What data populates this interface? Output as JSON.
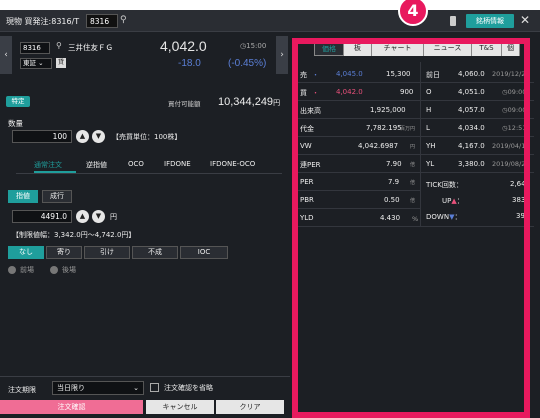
{
  "title": {
    "text": "現物 買発注:8316/T",
    "code": "8316",
    "info_button": "銘柄情報",
    "annotation_number": "4"
  },
  "stock": {
    "code": "8316",
    "name": "三井住友ＦＧ",
    "market": "東証",
    "lend_badge": "貸",
    "price": "4,042.0",
    "time": "15:00",
    "change": "-18.0",
    "change_pct": "(-0.45%)"
  },
  "order": {
    "special_badge": "特定",
    "buy_power_label": "買付可能額",
    "buy_power_value": "10,344,249",
    "buy_power_unit": "円",
    "qty_label": "数量",
    "qty_value": "100",
    "qty_unit": "【売買単位：100株】",
    "tabs": [
      "通常注文",
      "逆指値",
      "OCO",
      "IFDONE",
      "IFDONE-OCO"
    ],
    "price_type_limit": "指値",
    "price_type_market": "成行",
    "price_value": "4491.0",
    "yen": "円",
    "limit_range": "【制限値幅：3,342.0円〜4,742.0円】",
    "conditions": [
      "なし",
      "寄り",
      "引け",
      "不成",
      "IOC"
    ],
    "session_am": "前場",
    "session_pm": "後場",
    "period_label": "注文期限",
    "period_value": "当日限り",
    "skip_confirm": "注文確認を省略",
    "confirm_button": "注文確認",
    "cancel_button": "キャンセル",
    "clear_button": "クリア"
  },
  "info_panel": {
    "tabs": [
      "価格",
      "板",
      "チャート",
      "ニュース",
      "T&S",
      "個"
    ],
    "left_rows": [
      {
        "label": "売",
        "v1": "4,045.0",
        "v2": "15,300"
      },
      {
        "label": "買",
        "v1": "4,042.0",
        "v2": "900"
      },
      {
        "label": "出来高",
        "v1": "",
        "v2": "1,925,000"
      },
      {
        "label": "代金",
        "v1": "",
        "v2": "7,782.195",
        "unit": "百万円"
      },
      {
        "label": "VW",
        "v1": "",
        "v2": "4,042.6987",
        "unit": "円"
      },
      {
        "label": "連PER",
        "v1": "",
        "v2": "7.90",
        "unit": "倍"
      },
      {
        "label": "PER",
        "v1": "",
        "v2": "7.9",
        "unit": "倍"
      },
      {
        "label": "PBR",
        "v1": "",
        "v2": "0.50",
        "unit": "倍"
      },
      {
        "label": "YLD",
        "v1": "",
        "v2": "4.430",
        "unit": "%"
      }
    ],
    "right_rows": [
      {
        "label": "前日",
        "v1": "4,060.0",
        "v2": "2019/12/23"
      },
      {
        "label": "O",
        "v1": "4,051.0",
        "v2": "09:00"
      },
      {
        "label": "H",
        "v1": "4,057.0",
        "v2": "09:00"
      },
      {
        "label": "L",
        "v1": "4,034.0",
        "v2": "12:51"
      },
      {
        "label": "YH",
        "v1": "4,167.0",
        "v2": "2019/04/18"
      },
      {
        "label": "YL",
        "v1": "3,380.0",
        "v2": "2019/08/26"
      }
    ],
    "tick": {
      "label": "TICK回数：",
      "value": "2,64",
      "up_label": "UP",
      "up_value": "383",
      "down_label": "DOWN",
      "down_value": "39"
    }
  }
}
